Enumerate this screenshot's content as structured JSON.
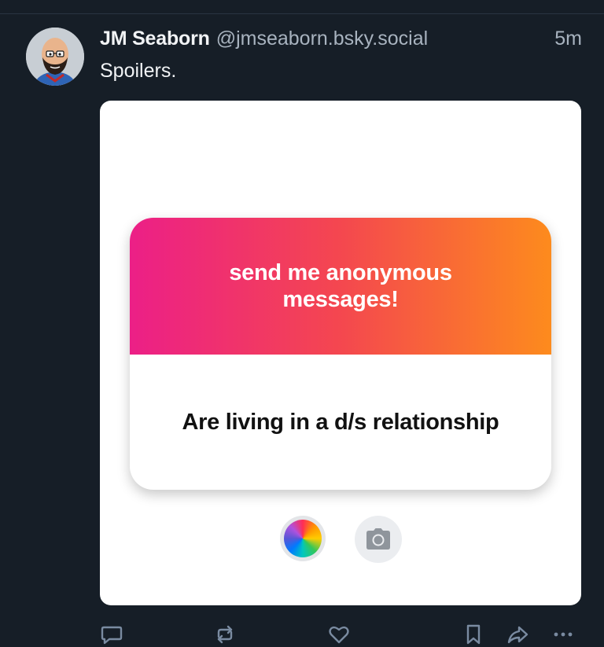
{
  "post": {
    "author_name": "JM Seaborn",
    "author_handle": "@jmseaborn.bsky.social",
    "timestamp": "5m",
    "text": "Spoilers."
  },
  "embed": {
    "header_text": "send me anonymous messages!",
    "question_text": "Are living in a d/s relationship",
    "controls": {
      "color_icon": "color-wheel-icon",
      "camera_icon": "camera-icon"
    }
  },
  "actions": {
    "icons": [
      "reply-icon",
      "repost-icon",
      "like-icon",
      "bookmark-icon",
      "share-icon",
      "more-icon"
    ]
  },
  "colors": {
    "background": "#161e27",
    "gradient_start": "#ec1f87",
    "gradient_end": "#fd8b1d",
    "muted_text": "#a8b3bf",
    "icon": "#7a8ba1"
  }
}
